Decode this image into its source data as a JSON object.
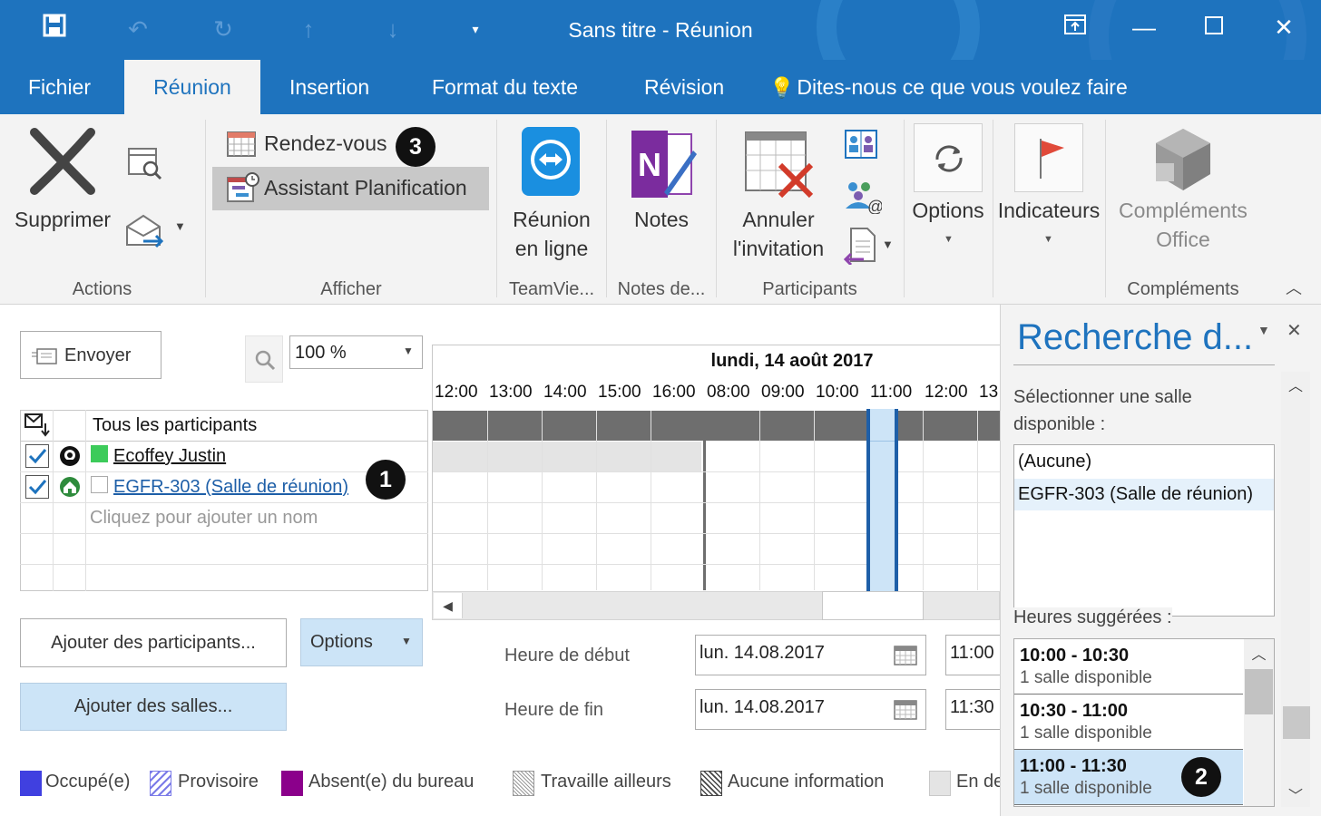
{
  "window": {
    "title": "Sans titre  -  Réunion",
    "quick_access": [
      "save-icon",
      "undo-icon",
      "redo-icon",
      "up-arrow-icon",
      "down-arrow-icon",
      "customize-icon"
    ]
  },
  "tabs": [
    {
      "label": "Fichier"
    },
    {
      "label": "Réunion",
      "active": true
    },
    {
      "label": "Insertion"
    },
    {
      "label": "Format du texte"
    },
    {
      "label": "Révision"
    },
    {
      "label": "Dites-nous ce que vous voulez faire"
    }
  ],
  "ribbon": {
    "actions": {
      "group_label": "Actions",
      "delete_label": "Supprimer"
    },
    "afficher": {
      "group_label": "Afficher",
      "appointment_label": "Rendez-vous",
      "scheduling_label": "Assistant Planification"
    },
    "teamviewer": {
      "group_label": "TeamVie...",
      "button_line1": "Réunion",
      "button_line2": "en ligne"
    },
    "notes": {
      "group_label": "Notes de...",
      "button_label": "Notes"
    },
    "participants": {
      "group_label": "Participants",
      "cancel_line1": "Annuler",
      "cancel_line2": "l'invitation"
    },
    "options": {
      "label": "Options"
    },
    "indicators": {
      "label": "Indicateurs"
    },
    "complements": {
      "group_label": "Compléments",
      "line1": "Compléments",
      "line2": "Office"
    }
  },
  "main": {
    "send_label": "Envoyer",
    "zoom_value": "100 %",
    "date_header": "lundi, 14 août 2017",
    "hours": [
      "12:00",
      "13:00",
      "14:00",
      "15:00",
      "16:00",
      "08:00",
      "09:00",
      "10:00",
      "11:00",
      "12:00",
      "13"
    ],
    "all_participants_label": "Tous les participants",
    "participants": [
      {
        "name": "Ecoffey Justin",
        "status_color": "#3ccb5a"
      },
      {
        "name": "EGFR-303 (Salle de réunion)",
        "status_color": "#ffffff"
      }
    ],
    "add_name_placeholder": "Cliquez pour ajouter un nom",
    "add_participants_label": "Ajouter des participants...",
    "options_label": "Options",
    "add_rooms_label": "Ajouter des salles...",
    "start_label": "Heure de début",
    "end_label": "Heure de fin",
    "start_date": "lun. 14.08.2017",
    "start_time": "11:00",
    "end_date": "lun. 14.08.2017",
    "end_time": "11:30",
    "legend": [
      {
        "label": "Occupé(e)",
        "color": "#4040e0"
      },
      {
        "label": "Provisoire",
        "color": "#7b7be8"
      },
      {
        "label": "Absent(e) du bureau",
        "color": "#8b008b"
      },
      {
        "label": "Travaille ailleurs",
        "color": "#999999"
      },
      {
        "label": "Aucune information",
        "color": "#444444"
      },
      {
        "label": "En de",
        "color": "#e4e4e4"
      }
    ]
  },
  "badges": {
    "one": "1",
    "two": "2",
    "three": "3"
  },
  "pane": {
    "title": "Recherche d...",
    "select_room_label": "Sélectionner une salle",
    "select_room_label2": "disponible :",
    "rooms": [
      "(Aucune)",
      "EGFR-303 (Salle de réunion)"
    ],
    "suggested_label": "Heures suggérées :",
    "suggestions": [
      {
        "time": "10:00 - 10:30",
        "sub": "1 salle disponible"
      },
      {
        "time": "10:30 - 11:00",
        "sub": "1 salle disponible"
      },
      {
        "time": "11:00 - 11:30",
        "sub": "1 salle disponible"
      }
    ]
  }
}
